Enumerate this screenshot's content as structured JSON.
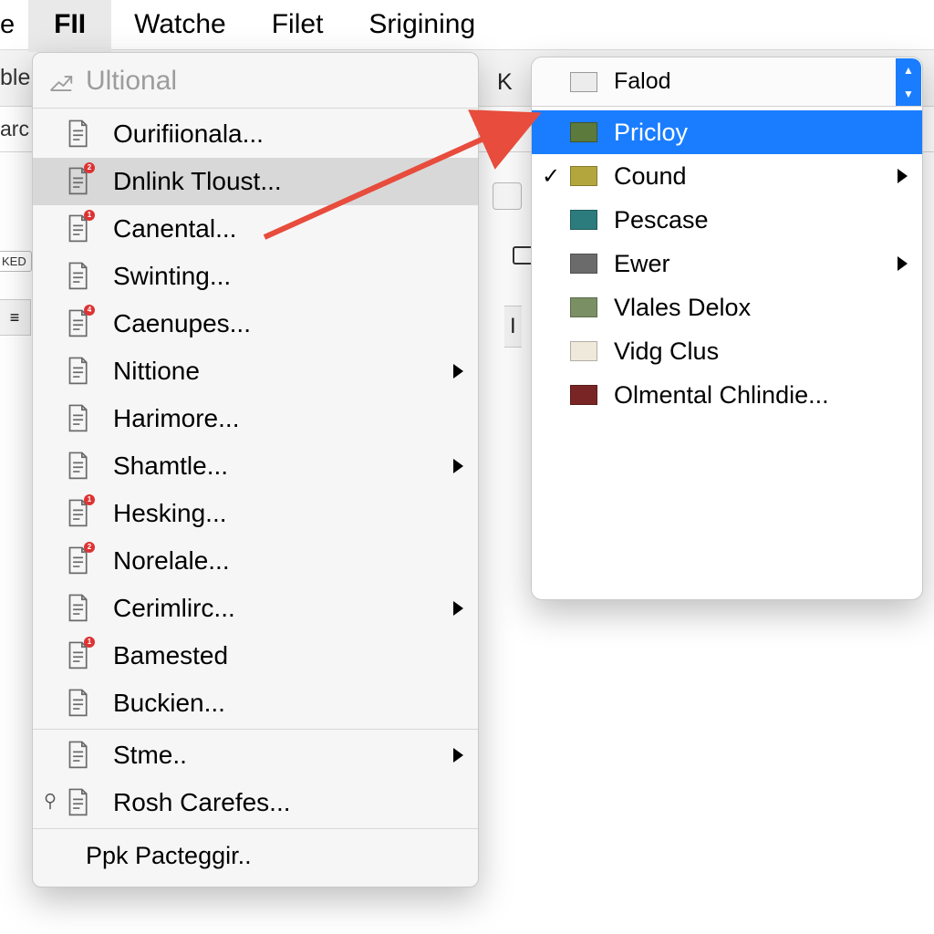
{
  "menubar": {
    "items": [
      {
        "label": "e"
      },
      {
        "label": "FII"
      },
      {
        "label": "Watche"
      },
      {
        "label": "Filet"
      },
      {
        "label": "Srigining"
      }
    ],
    "active_index": 1
  },
  "background": {
    "toolrow_left": "ble",
    "toolrow2_left": "arc",
    "ked_chip": "KED",
    "k_label": "K",
    "in_label": "I",
    "toolbar_glyph": "≡"
  },
  "dropdown": {
    "header": "Ultional",
    "sections": [
      [
        {
          "label": "Ourifiionala...",
          "badge": "",
          "submenu": false
        },
        {
          "label": "Dnlink Tloust...",
          "badge": "2",
          "submenu": false,
          "hovered": true
        },
        {
          "label": "Canental...",
          "badge": "1",
          "submenu": false
        },
        {
          "label": "Swinting...",
          "badge": "",
          "submenu": false
        },
        {
          "label": "Caenupes...",
          "badge": "4",
          "submenu": false
        },
        {
          "label": "Nittione",
          "badge": "",
          "submenu": true
        },
        {
          "label": "Harimore...",
          "badge": "",
          "submenu": false
        },
        {
          "label": "Shamtle...",
          "badge": "",
          "submenu": true
        },
        {
          "label": "Hesking...",
          "badge": "1",
          "submenu": false
        },
        {
          "label": "Norelale...",
          "badge": "2",
          "submenu": false
        },
        {
          "label": "Cerimlirc...",
          "badge": "",
          "submenu": true
        },
        {
          "label": "Bamested",
          "badge": "1",
          "submenu": false
        },
        {
          "label": "Buckien...",
          "badge": "",
          "submenu": false
        }
      ],
      [
        {
          "label": "Stme..",
          "badge": "",
          "submenu": true
        },
        {
          "label": "Rosh Carefes...",
          "badge": "",
          "submenu": false,
          "pin": true
        }
      ],
      [
        {
          "label": "Ppk Pacteggir..",
          "badge": "",
          "submenu": false,
          "no_icon": true
        }
      ]
    ]
  },
  "colorpanel": {
    "header_label": "Falod",
    "header_swatch": "#ececec",
    "items": [
      {
        "label": "Pricloy",
        "color": "#5d7a3d",
        "selected": true,
        "checked": false,
        "submenu": false
      },
      {
        "label": "Cound",
        "color": "#b3a63c",
        "selected": false,
        "checked": true,
        "submenu": true
      },
      {
        "label": "Pescase",
        "color": "#2c7b7d",
        "selected": false,
        "checked": false,
        "submenu": false
      },
      {
        "label": "Ewer",
        "color": "#6b6b6b",
        "selected": false,
        "checked": false,
        "submenu": true
      },
      {
        "label": "Vlales Delox",
        "color": "#7a8f63",
        "selected": false,
        "checked": false,
        "submenu": false
      },
      {
        "label": "Vidg Clus",
        "color": "#efe9dc",
        "selected": false,
        "checked": false,
        "submenu": false
      },
      {
        "label": "Olmental Chlindie...",
        "color": "#7a2525",
        "selected": false,
        "checked": false,
        "submenu": false
      }
    ]
  },
  "checkmark_glyph": "✓"
}
